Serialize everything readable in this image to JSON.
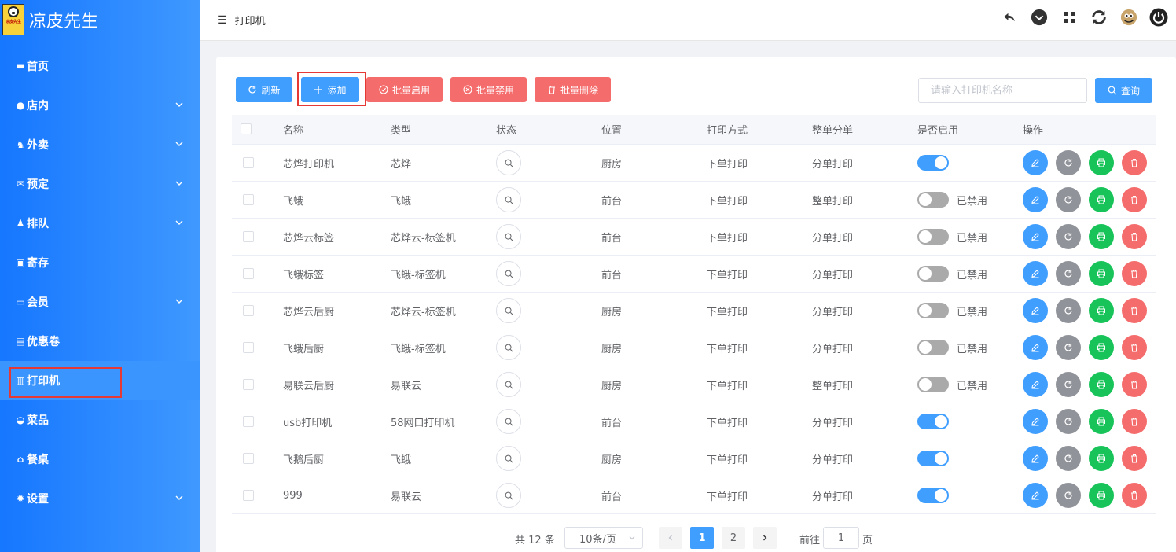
{
  "app": {
    "name": "凉皮先生",
    "logo_text": "凉皮先生"
  },
  "sidebar": {
    "items": [
      {
        "label": "首页",
        "icon": "home-icon",
        "has_children": false
      },
      {
        "label": "店内",
        "icon": "user-icon",
        "has_children": true
      },
      {
        "label": "外卖",
        "icon": "scooter-icon",
        "has_children": true
      },
      {
        "label": "预定",
        "icon": "reserve-icon",
        "has_children": true
      },
      {
        "label": "排队",
        "icon": "queue-icon",
        "has_children": true
      },
      {
        "label": "寄存",
        "icon": "briefcase-icon",
        "has_children": false
      },
      {
        "label": "会员",
        "icon": "card-icon",
        "has_children": true
      },
      {
        "label": "优惠卷",
        "icon": "ticket-icon",
        "has_children": false
      },
      {
        "label": "打印机",
        "icon": "printer-icon",
        "has_children": false,
        "active": true
      },
      {
        "label": "菜品",
        "icon": "dish-icon",
        "has_children": false
      },
      {
        "label": "餐桌",
        "icon": "table-icon",
        "has_children": false
      },
      {
        "label": "设置",
        "icon": "gear-icon",
        "has_children": true
      }
    ]
  },
  "header": {
    "breadcrumb": "打印机"
  },
  "toolbar": {
    "refresh": "刷新",
    "add": "添加",
    "batch_enable": "批量启用",
    "batch_disable": "批量禁用",
    "batch_delete": "批量删除",
    "search_placeholder": "请输入打印机名称",
    "search_button": "查询"
  },
  "table": {
    "columns": [
      "名称",
      "类型",
      "状态",
      "位置",
      "打印方式",
      "整单分单",
      "是否启用",
      "操作"
    ],
    "rows": [
      {
        "name": "芯烨打印机",
        "type": "芯烨",
        "location": "厨房",
        "print_mode": "下单打印",
        "split": "分单打印",
        "enabled": true,
        "enabled_label": ""
      },
      {
        "name": "飞蛾",
        "type": "飞蛾",
        "location": "前台",
        "print_mode": "下单打印",
        "split": "整单打印",
        "enabled": false,
        "enabled_label": "已禁用"
      },
      {
        "name": "芯烨云标签",
        "type": "芯烨云-标签机",
        "location": "前台",
        "print_mode": "下单打印",
        "split": "分单打印",
        "enabled": false,
        "enabled_label": "已禁用"
      },
      {
        "name": "飞蛾标签",
        "type": "飞蛾-标签机",
        "location": "前台",
        "print_mode": "下单打印",
        "split": "分单打印",
        "enabled": false,
        "enabled_label": "已禁用"
      },
      {
        "name": "芯烨云后厨",
        "type": "芯烨云-标签机",
        "location": "厨房",
        "print_mode": "下单打印",
        "split": "分单打印",
        "enabled": false,
        "enabled_label": "已禁用"
      },
      {
        "name": "飞蛾后厨",
        "type": "飞蛾-标签机",
        "location": "厨房",
        "print_mode": "下单打印",
        "split": "分单打印",
        "enabled": false,
        "enabled_label": "已禁用"
      },
      {
        "name": "易联云后厨",
        "type": "易联云",
        "location": "厨房",
        "print_mode": "下单打印",
        "split": "整单打印",
        "enabled": false,
        "enabled_label": "已禁用"
      },
      {
        "name": "usb打印机",
        "type": "58网口打印机",
        "location": "前台",
        "print_mode": "下单打印",
        "split": "分单打印",
        "enabled": true,
        "enabled_label": ""
      },
      {
        "name": "飞鹅后厨",
        "type": "飞蛾",
        "location": "厨房",
        "print_mode": "下单打印",
        "split": "分单打印",
        "enabled": true,
        "enabled_label": ""
      },
      {
        "name": "999",
        "type": "易联云",
        "location": "前台",
        "print_mode": "下单打印",
        "split": "分单打印",
        "enabled": true,
        "enabled_label": ""
      }
    ]
  },
  "pagination": {
    "total": "共 12 条",
    "page_size": "10条/页",
    "pages": [
      "1",
      "2"
    ],
    "current": "1",
    "goto_prefix": "前往",
    "goto_value": "1",
    "goto_suffix": "页"
  },
  "colors": {
    "primary": "#409eff",
    "danger": "#f56c6c",
    "success": "#18c45a",
    "info": "#909399",
    "sidebar": "#1677ff",
    "highlight_border": "#e53935"
  }
}
